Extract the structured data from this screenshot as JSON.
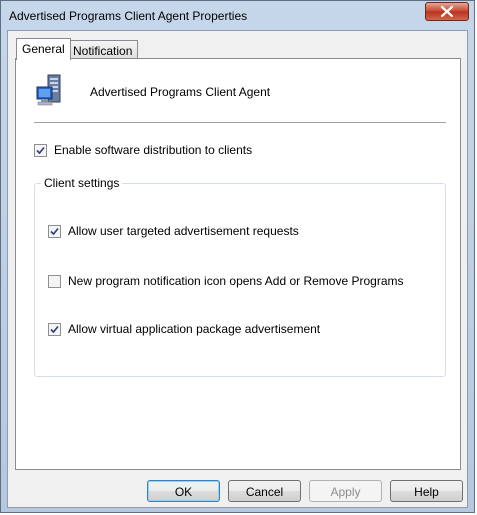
{
  "window": {
    "title": "Advertised Programs Client Agent Properties"
  },
  "tabs": [
    {
      "label": "General",
      "active": true
    },
    {
      "label": "Notification",
      "active": false
    }
  ],
  "general": {
    "agent_name": "Advertised Programs Client Agent",
    "agent_icon": "computer-icon",
    "enable_distribution": {
      "label": "Enable software distribution to clients",
      "checked": true
    },
    "client_settings": {
      "title": "Client settings",
      "options": [
        {
          "label": "Allow user targeted advertisement requests",
          "checked": true
        },
        {
          "label": "New program notification icon opens Add or Remove Programs",
          "checked": false
        },
        {
          "label": "Allow virtual application package advertisement",
          "checked": true
        }
      ]
    }
  },
  "buttons": {
    "ok": "OK",
    "cancel": "Cancel",
    "apply": "Apply",
    "help": "Help"
  },
  "colors": {
    "titlebar": "#c7d7ea",
    "close_button": "#c7432c",
    "default_button_border": "#3c7fb1"
  }
}
